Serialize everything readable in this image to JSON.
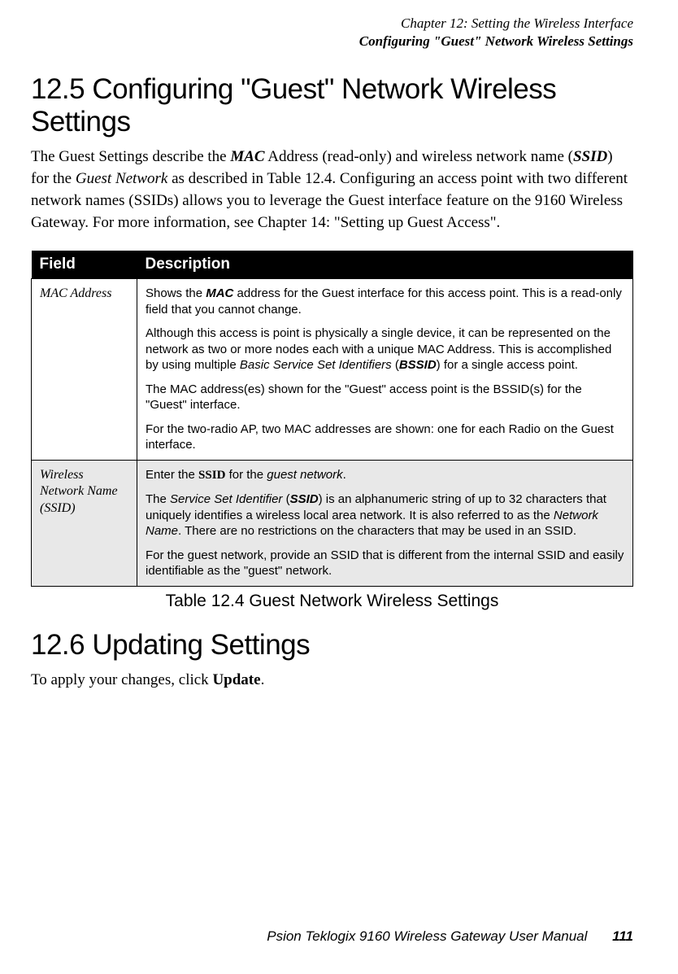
{
  "header": {
    "line1": "Chapter 12:  Setting the Wireless Interface",
    "line2": "Configuring \"Guest\" Network Wireless Settings"
  },
  "section125": {
    "heading": "12.5  Configuring \"Guest\" Network Wireless Settings",
    "para_pre": "The Guest Settings describe the ",
    "para_mac": "MAC",
    "para_mid1": " Address (read-only) and wireless network name (",
    "para_ssid": "SSID",
    "para_mid2": ") for the ",
    "para_guestnet": "Guest Network",
    "para_post": " as described in Table 12.4. Configuring an access point with two different network names (SSIDs) allows you to leverage the Guest interface feature on the 9160 Wireless Gateway. For more information, see Chapter 14: \"Setting up Guest Access\"."
  },
  "table": {
    "header_field": "Field",
    "header_desc": "Description",
    "rows": [
      {
        "field": "MAC Address",
        "alt": false,
        "desc": [
          {
            "parts": [
              {
                "t": "Shows the "
              },
              {
                "t": "MAC",
                "b": true,
                "i": true
              },
              {
                "t": " address for the Guest interface for this access point. This is a read-only field that you cannot change."
              }
            ]
          },
          {
            "parts": [
              {
                "t": "Although this access is point is physically a single device, it can be represented on the network as two or more nodes each with a unique MAC Address. This is accomplished by using multiple "
              },
              {
                "t": "Basic Service Set Identifiers",
                "i": true
              },
              {
                "t": " ("
              },
              {
                "t": "BSSID",
                "b": true,
                "i": true
              },
              {
                "t": ") for a single access point."
              }
            ]
          },
          {
            "parts": [
              {
                "t": "The MAC address(es) shown for the \"Guest\" access point is the BSSID(s) for the \"Guest\" interface."
              }
            ]
          },
          {
            "parts": [
              {
                "t": "For the two-radio AP, two MAC addresses are shown: one for each Radio on the Guest interface."
              }
            ]
          }
        ]
      },
      {
        "field": "Wireless Network Name (SSID)",
        "alt": true,
        "desc": [
          {
            "parts": [
              {
                "t": "Enter the "
              },
              {
                "t": "SSID",
                "serifbold": true
              },
              {
                "t": " for the "
              },
              {
                "t": "guest network",
                "i": true
              },
              {
                "t": "."
              }
            ]
          },
          {
            "parts": [
              {
                "t": "The "
              },
              {
                "t": "Service Set Identifier",
                "i": true
              },
              {
                "t": " ("
              },
              {
                "t": "SSID",
                "b": true,
                "i": true
              },
              {
                "t": ") is an alphanumeric string of up to 32 characters that uniquely identifies a wireless local area network. It is also referred to as the "
              },
              {
                "t": "Network Name",
                "i": true
              },
              {
                "t": ". There are no restrictions on the characters that may be used in an SSID."
              }
            ]
          },
          {
            "parts": [
              {
                "t": "For the guest network, provide an SSID that is different from the internal SSID and easily identifiable as the \"guest\" network."
              }
            ]
          }
        ]
      }
    ],
    "caption": "Table 12.4 Guest Network Wireless Settings"
  },
  "section126": {
    "heading": "12.6  Updating Settings",
    "para_pre": "To apply your changes, click ",
    "para_update": "Update",
    "para_post": "."
  },
  "footer": {
    "text": "Psion Teklogix 9160 Wireless Gateway User Manual",
    "page": "111"
  }
}
